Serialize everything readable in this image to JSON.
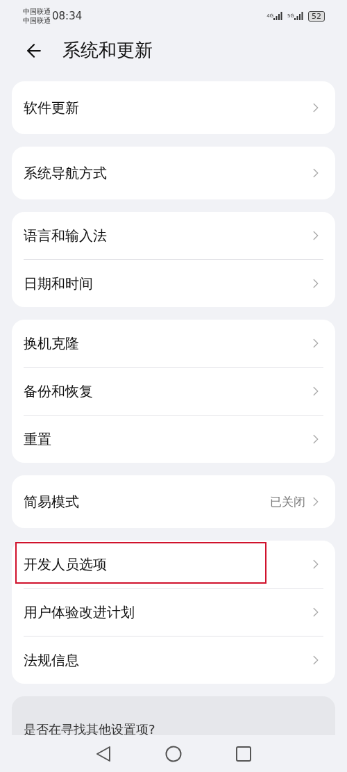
{
  "status_bar": {
    "carriers": [
      "中国联通",
      "中国联通"
    ],
    "time": "08:34",
    "networks": [
      "4G",
      "5G"
    ],
    "battery": "52"
  },
  "header": {
    "title": "系统和更新"
  },
  "groups": [
    {
      "items": [
        {
          "label": "软件更新",
          "highlighted": false
        }
      ]
    },
    {
      "items": [
        {
          "label": "系统导航方式",
          "highlighted": false
        }
      ]
    },
    {
      "items": [
        {
          "label": "语言和输入法",
          "highlighted": false
        },
        {
          "label": "日期和时间",
          "highlighted": false
        }
      ]
    },
    {
      "items": [
        {
          "label": "换机克隆",
          "highlighted": false
        },
        {
          "label": "备份和恢复",
          "highlighted": false
        },
        {
          "label": "重置",
          "highlighted": false
        }
      ]
    },
    {
      "items": [
        {
          "label": "简易模式",
          "value": "已关闭",
          "highlighted": false
        }
      ]
    },
    {
      "items": [
        {
          "label": "开发人员选项",
          "highlighted": true
        },
        {
          "label": "用户体验改进计划",
          "highlighted": false
        },
        {
          "label": "法规信息",
          "highlighted": false
        }
      ]
    }
  ],
  "hint": {
    "text": "是否在寻找其他设置项?"
  }
}
